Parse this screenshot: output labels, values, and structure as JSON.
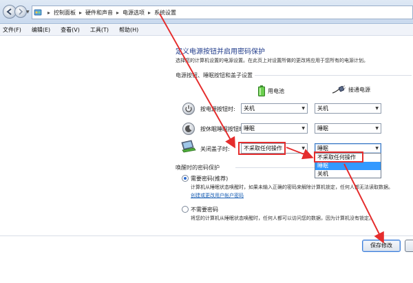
{
  "breadcrumb": {
    "items": [
      "控制面板",
      "硬件和声音",
      "电源选项",
      "系统设置"
    ]
  },
  "menubar": {
    "items": [
      "文件(F)",
      "编辑(E)",
      "查看(V)",
      "工具(T)",
      "帮助(H)"
    ]
  },
  "page": {
    "heading": "定义电源按钮并启用密码保护",
    "subtext": "选择您的计算机设置的电源设置。在此页上对设置所做的更改将应用于您所有的电源计划。",
    "section1_title": "电源按钮、睡眠按钮和盖子设置",
    "columns": {
      "battery": "用电池",
      "plugged": "接通电源"
    },
    "rows": [
      {
        "label": "按电源按钮时:",
        "battery": "关机",
        "plugged": "关机"
      },
      {
        "label": "按休眠睡眠按钮时:",
        "battery": "睡眠",
        "plugged": "睡眠"
      },
      {
        "label": "关闭盖子时:",
        "battery": "不采取任何操作",
        "plugged": "睡眠"
      }
    ],
    "dropdown_options": [
      "不采取任何操作",
      "睡眠",
      "关机"
    ],
    "dropdown_highlighted": "睡眠",
    "section2_title": "唤醒时的密码保护",
    "option1": {
      "title": "需要密码(推荐)",
      "desc": "计算机从睡眠状态唤醒时，如果未输入正确的密码来解除计算机锁定，任何人都无法读取数据。",
      "link": "创建或更改用户帐户密码",
      "selected": true
    },
    "option2": {
      "title": "不需要密码",
      "desc": "将您的计算机从睡眠状态唤醒时，任何人都可以访问您的数据，因为计算机没有锁定。",
      "selected": false
    },
    "save_label": "保存修改"
  },
  "colors": {
    "heading": "#1e3a8a",
    "annotation": "#e52d2d",
    "highlight": "#3399ff",
    "link": "#1a5fb4"
  },
  "icons": [
    "back-icon",
    "forward-icon",
    "control-panel-icon",
    "battery-icon",
    "plug-icon",
    "power-icon",
    "sleep-icon",
    "laptop-lid-icon"
  ]
}
